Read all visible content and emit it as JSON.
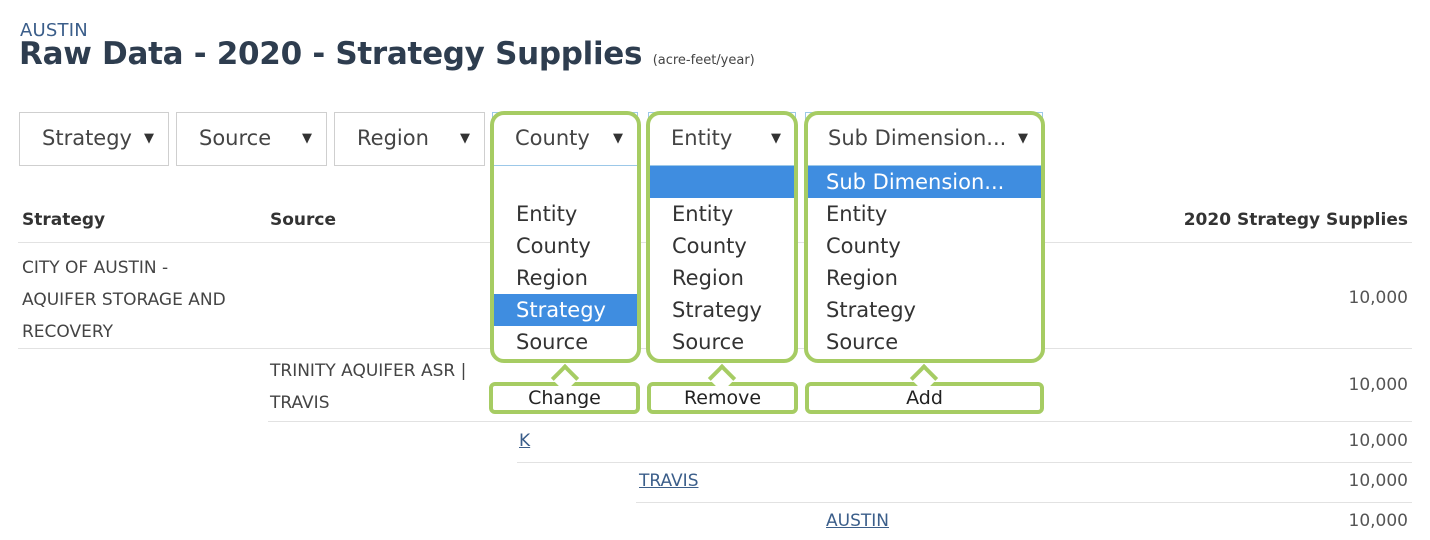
{
  "header": {
    "location": "AUSTIN",
    "title": "Raw Data - 2020 - Strategy Supplies",
    "unit": "(acre-feet/year)"
  },
  "filters": [
    {
      "label": "Strategy"
    },
    {
      "label": "Source"
    },
    {
      "label": "Region"
    },
    {
      "label": "County"
    },
    {
      "label": "Entity"
    },
    {
      "label": "Sub Dimension..."
    }
  ],
  "dropdowns": {
    "county": {
      "options": [
        "Entity",
        "County",
        "Region",
        "Strategy",
        "Source"
      ],
      "selected": "Strategy"
    },
    "entity": {
      "options": [
        "",
        "Entity",
        "County",
        "Region",
        "Strategy",
        "Source"
      ],
      "selected": ""
    },
    "sub_dimension": {
      "options": [
        "Sub Dimension...",
        "Entity",
        "County",
        "Region",
        "Strategy",
        "Source"
      ],
      "selected": "Sub Dimension..."
    }
  },
  "callouts": {
    "change": "Change",
    "remove": "Remove",
    "add": "Add"
  },
  "table": {
    "headers": {
      "strategy": "Strategy",
      "source": "Source",
      "value": "2020 Strategy Supplies"
    },
    "strategy_name": [
      "CITY OF AUSTIN -",
      "AQUIFER STORAGE AND",
      "RECOVERY"
    ],
    "strategy_value": "10,000",
    "source_name": [
      "TRINITY AQUIFER ASR |",
      "TRAVIS"
    ],
    "source_value": "10,000",
    "region_link": "K",
    "region_value": "10,000",
    "county_link": "TRAVIS",
    "county_value": "10,000",
    "entity_link": "AUSTIN",
    "entity_value": "10,000"
  },
  "colors": {
    "accent_green": "#a6cc63",
    "selection_blue": "#3f8de0",
    "title_navy": "#2e3d4f"
  }
}
